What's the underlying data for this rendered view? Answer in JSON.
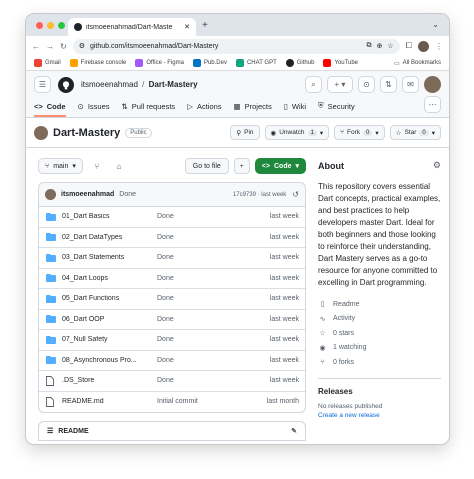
{
  "browser": {
    "tab_title": "itsmoeenahmad/Dart-Maste",
    "url": "github.com/itsmoeenahmad/Dart-Mastery",
    "bookmarks": [
      "Gmail",
      "Firebase console",
      "Office - Figma",
      "Pub.Dev",
      "CHAT GPT",
      "Github",
      "YouTube"
    ],
    "all_bookmarks": "All Bookmarks"
  },
  "header": {
    "owner": "itsmoeenahmad",
    "slash": "/",
    "repo": "Dart-Mastery"
  },
  "repo_nav": {
    "code": "Code",
    "issues": "Issues",
    "pull_requests": "Pull requests",
    "actions": "Actions",
    "projects": "Projects",
    "wiki": "Wiki",
    "security": "Security"
  },
  "title_row": {
    "name": "Dart-Mastery",
    "visibility": "Public",
    "pin": "Pin",
    "unwatch": "Unwatch",
    "unwatch_count": "1",
    "fork": "Fork",
    "fork_count": "0",
    "star": "Star",
    "star_count": "0"
  },
  "toolbar": {
    "branch": "main",
    "go_to_file": "Go to file",
    "code": "Code"
  },
  "commit": {
    "author": "itsmoeenahmad",
    "message": "Done",
    "hash": "17c9739 · last week"
  },
  "files": [
    {
      "type": "dir",
      "name": "01_Dart Basics",
      "commit": "Done",
      "age": "last week"
    },
    {
      "type": "dir",
      "name": "02_Dart DataTypes",
      "commit": "Done",
      "age": "last week"
    },
    {
      "type": "dir",
      "name": "03_Dart Statements",
      "commit": "Done",
      "age": "last week"
    },
    {
      "type": "dir",
      "name": "04_Dart Loops",
      "commit": "Done",
      "age": "last week"
    },
    {
      "type": "dir",
      "name": "05_Dart Functions",
      "commit": "Done",
      "age": "last week"
    },
    {
      "type": "dir",
      "name": "06_Dart OOP",
      "commit": "Done",
      "age": "last week"
    },
    {
      "type": "dir",
      "name": "07_Null Safety",
      "commit": "Done",
      "age": "last week"
    },
    {
      "type": "dir",
      "name": "08_Asynchronous Pro...",
      "commit": "Done",
      "age": "last week"
    },
    {
      "type": "file",
      "name": ".DS_Store",
      "commit": "Done",
      "age": "last week"
    },
    {
      "type": "file",
      "name": "README.md",
      "commit": "Initial commit",
      "age": "last month"
    }
  ],
  "readme": {
    "label": "README"
  },
  "about": {
    "heading": "About",
    "description": "This repository covers essential Dart concepts, practical examples, and best practices to help developers master Dart. Ideal for both beginners and those looking to reinforce their understanding, Dart Mastery serves as a go-to resource for anyone committed to excelling in Dart programming.",
    "readme": "Readme",
    "activity": "Activity",
    "stars": "0 stars",
    "watching": "1 watching",
    "forks": "0 forks"
  },
  "releases": {
    "heading": "Releases",
    "none": "No releases published",
    "create": "Create a new release"
  },
  "colors": {
    "accent_green": "#1f883d",
    "folder_blue": "#54aeff",
    "link_blue": "#0969da",
    "underline": "#fd8c73"
  }
}
